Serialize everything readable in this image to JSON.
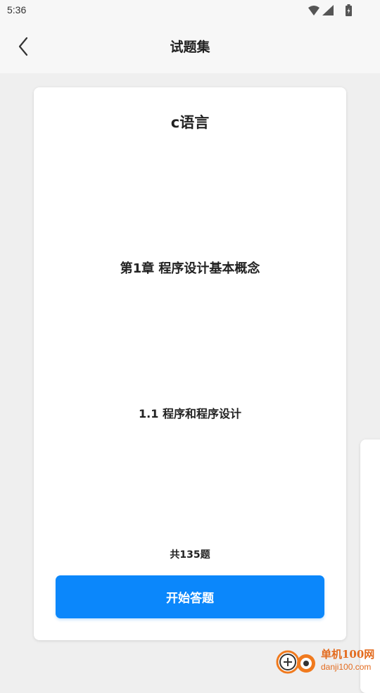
{
  "status_bar": {
    "time": "5:36",
    "icons": [
      "wifi-icon",
      "signal-icon",
      "battery-icon"
    ]
  },
  "header": {
    "title": "试题集",
    "back_icon": "chevron-left-icon"
  },
  "card": {
    "title": "c语言",
    "chapter": "第1章 程序设计基本概念",
    "section": "1.1 程序和程序设计",
    "count": "共135题",
    "start_label": "开始答题"
  },
  "watermark": {
    "name": "单机100网",
    "url": "danji100.com"
  },
  "colors": {
    "accent": "#0b87fb",
    "background": "#efefef",
    "header_bg": "#f7f7f7",
    "card_bg": "#ffffff",
    "watermark": "#e36b1e"
  }
}
